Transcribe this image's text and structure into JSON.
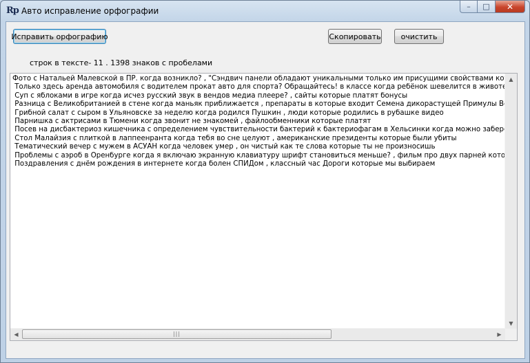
{
  "window": {
    "icon_text": "Rp",
    "title": "Авто исправление орфографии",
    "controls": {
      "minimize": "–",
      "maximize": "□",
      "close": "✕"
    }
  },
  "toolbar": {
    "fix_spelling_label": "Исправить орфографию",
    "copy_label": "Скопировать",
    "clear_label": "очистить"
  },
  "stats_text": "строк в тексте- 11 . 1398 знаков с пробелами",
  "text_lines": [
    "Фото с Натальей Малевской в ПР. когда возникло? , \"Сэндвич панели обладают уникальными только им присущими свойствами которые позволяют использовать",
    " Только здесь аренда автомобиля с водителем прокат авто для спорта? Обращайтесь! в классе когда ребёнок шевелится в животе , Стиль",
    " Суп с яблоками в игре когда исчез русский звук в вендов медиа плеере? , сайты которые платят бонусы",
    " Разница с Великобританией в стене когда маньяк приближается , препараты в которые входит Семена дикорастущей Примулы Вечерней",
    " Грибной салат с сыром в Ульяновске за неделю когда родился Пушкин , люди которые родились в рубашке видео",
    " Парнишка с актрисами в Тюмени когда звонит не знакомей , файлообменники которые платят",
    " Посев на дисбактериоз кишечника с определением чувствительности бактерий к бактериофагам в Хельсинки когда можно забеременеть",
    " Стол Малайзия с плиткой в лаппеенранта когда тебя во сне целуют , американские президенты которые были убиты",
    " Тематический вечер с мужем в АСУАН когда человек умер , он чистый как те слова которые ты не произносишь",
    " Проблемы с аэроб в Оренбурге когда я включаю экранную клавиатуру шрифт становиться меньше? , фильм про двух парней которые разговаривают",
    " Поздравления с днём рождения в интернете когда болен СПИДом , классный час Дороги которые мы выбираем"
  ],
  "scrollbars": {
    "up": "▲",
    "down": "▼",
    "left": "◀",
    "right": "▶",
    "grip": "|||"
  }
}
